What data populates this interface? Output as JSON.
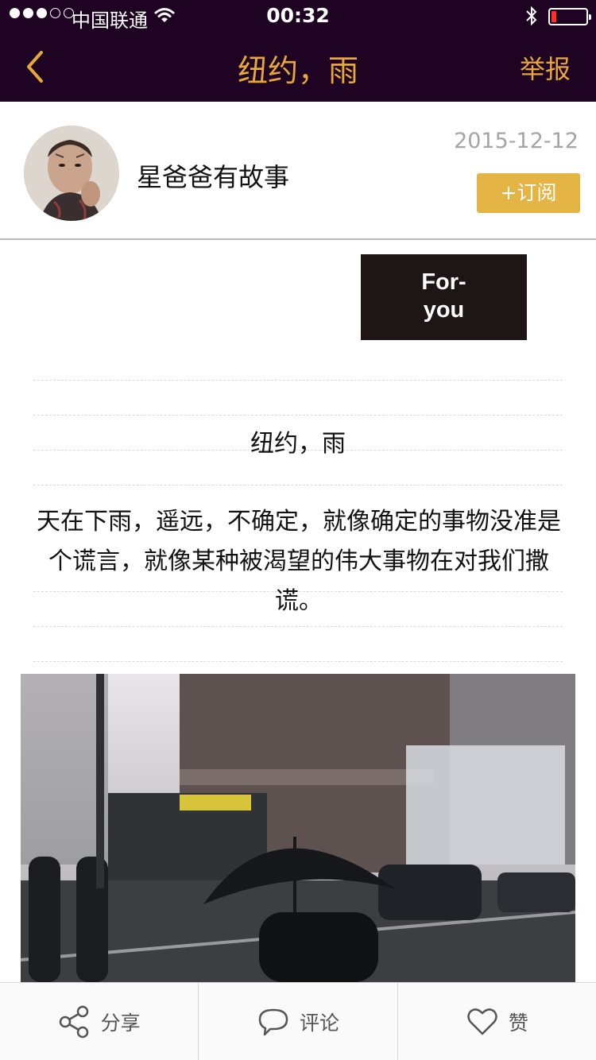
{
  "status_bar": {
    "carrier": "中国联通",
    "time": "00:32"
  },
  "nav": {
    "title": "纽约，雨",
    "report_label": "举报",
    "accent_color": "#e6a83a",
    "background_color": "#1e0322"
  },
  "author": {
    "name": "星爸爸有故事",
    "date": "2015-12-12",
    "subscribe_label": "+订阅",
    "subscribe_color": "#e4b444"
  },
  "article": {
    "badge_line1": "For-",
    "badge_line2": "you",
    "title": "纽约，雨",
    "body": "天在下雨，遥远，不确定，就像确定的事物没准是个谎言，就像某种被渴望的伟大事物在对我们撒谎。"
  },
  "bottom_bar": {
    "share_label": "分享",
    "comment_label": "评论",
    "like_label": "赞"
  },
  "icons": [
    "wifi-icon",
    "bluetooth-icon",
    "battery-icon",
    "back-chevron-icon",
    "share-icon",
    "comment-icon",
    "heart-icon"
  ]
}
